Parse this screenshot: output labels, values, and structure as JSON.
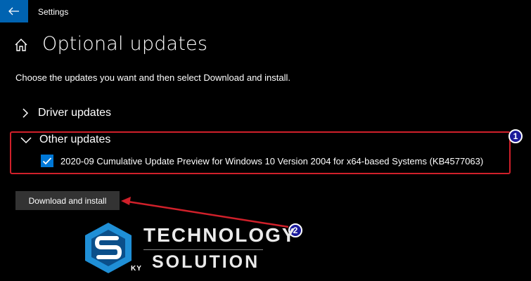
{
  "window": {
    "app_title": "Settings"
  },
  "header": {
    "title": "Optional updates"
  },
  "instructions": "Choose the updates you want and then select Download and install.",
  "sections": [
    {
      "label": "Driver updates",
      "expanded": false
    },
    {
      "label": "Other updates",
      "expanded": true
    }
  ],
  "other_updates": [
    {
      "label": "2020-09 Cumulative Update Preview for Windows 10 Version 2004 for x64-based Systems (KB4577063)",
      "checked": true
    }
  ],
  "download_button": {
    "label": "Download and install"
  },
  "annotations": {
    "badge_1": "1",
    "badge_2": "2",
    "highlight_color": "#d0202a",
    "badge_color": "#1a1a9a"
  },
  "watermark": {
    "line1": "TECHNOLOGY",
    "line2": "SOLUTION",
    "logo_text": "KY"
  },
  "colors": {
    "accent": "#0078d7",
    "back_button": "#0063b1",
    "button_bg": "#333333"
  }
}
